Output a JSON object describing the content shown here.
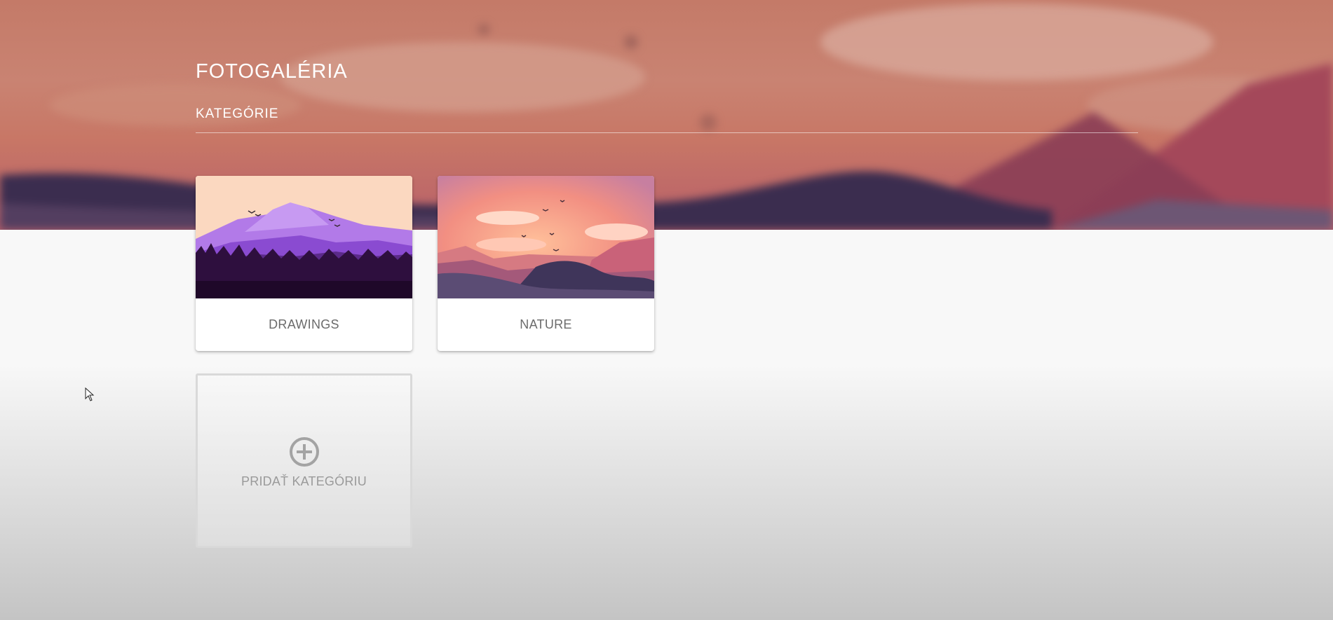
{
  "header": {
    "title": "FOTOGALÉRIA",
    "subtitle": "KATEGÓRIE"
  },
  "categories": [
    {
      "label": "DRAWINGS",
      "image_icon": "purple-mountain-forest-illustration"
    },
    {
      "label": "NATURE",
      "image_icon": "sunset-mountain-illustration"
    }
  ],
  "add_category": {
    "label": "PRIDAŤ KATEGÓRIU",
    "icon": "plus-circle-icon"
  },
  "colors": {
    "hero_top": "#c47a68",
    "hero_bottom": "#b8606a",
    "card_label": "#6b6b6b",
    "add_label": "#9a9a9a"
  }
}
